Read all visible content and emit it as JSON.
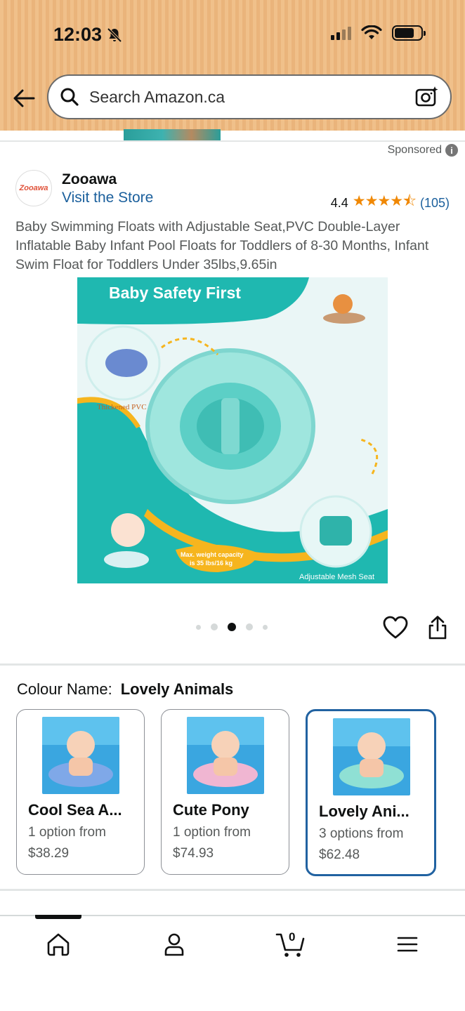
{
  "status_bar": {
    "time": "12:03"
  },
  "search": {
    "placeholder": "Search Amazon.ca"
  },
  "ad": {
    "sponsored_label": "Sponsored"
  },
  "brand": {
    "logo_text": "Zooawa",
    "name": "Zooawa",
    "visit_store": "Visit the Store"
  },
  "rating": {
    "value": "4.4",
    "stars": 4.4,
    "count": "(105)"
  },
  "product": {
    "title": "Baby Swimming Floats with Adjustable Seat,PVC Double-Layer Inflatable Baby Infant Pool Floats for Toddlers of 8-30 Months, Infant Swim Float for Toddlers Under 35lbs,9.65in"
  },
  "product_image": {
    "headline": "Baby Safety First",
    "label_pvc": "Thickened PVC",
    "label_weight_line1": "Max. weight capacity",
    "label_weight_line2": "is 35 lbs/16 kg",
    "label_seat": "Adjustable Mesh Seat",
    "accent_teal": "#1fb8b0",
    "accent_yellow": "#f6b51e"
  },
  "carousel": {
    "count": 5,
    "active_index": 2
  },
  "colour": {
    "label": "Colour Name:",
    "selected": "Lovely Animals",
    "options": [
      {
        "name": "Cool Sea A...",
        "options_text": "1 option from",
        "price": "$38.29"
      },
      {
        "name": "Cute Pony",
        "options_text": "1 option from",
        "price": "$74.93"
      },
      {
        "name": "Lovely Ani...",
        "options_text": "3 options from",
        "price": "$62.48"
      }
    ]
  },
  "bottom_nav": {
    "cart_count": "0",
    "items": [
      "home-icon",
      "account-icon",
      "cart-icon",
      "menu-icon"
    ]
  }
}
